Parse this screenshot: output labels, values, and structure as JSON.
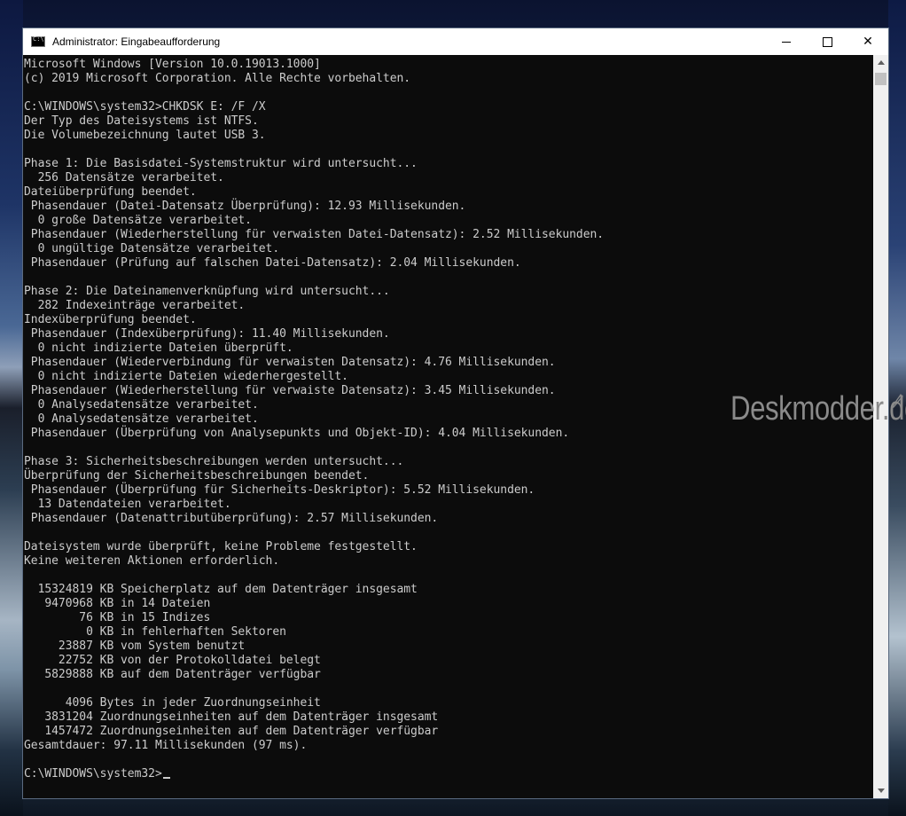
{
  "window": {
    "title": "Administrator: Eingabeaufforderung",
    "icon": "cmd-icon",
    "controls": {
      "minimize": "minimize-icon",
      "maximize": "maximize-icon",
      "close": "✕"
    }
  },
  "console": {
    "lines": [
      "Microsoft Windows [Version 10.0.19013.1000]",
      "(c) 2019 Microsoft Corporation. Alle Rechte vorbehalten.",
      "",
      "C:\\WINDOWS\\system32>CHKDSK E: /F /X",
      "Der Typ des Dateisystems ist NTFS.",
      "Die Volumebezeichnung lautet USB 3.",
      "",
      "Phase 1: Die Basisdatei-Systemstruktur wird untersucht...",
      "  256 Datensätze verarbeitet.",
      "Dateiüberprüfung beendet.",
      " Phasendauer (Datei-Datensatz Überprüfung): 12.93 Millisekunden.",
      "  0 große Datensätze verarbeitet.",
      " Phasendauer (Wiederherstellung für verwaisten Datei-Datensatz): 2.52 Millisekunden.",
      "  0 ungültige Datensätze verarbeitet.",
      " Phasendauer (Prüfung auf falschen Datei-Datensatz): 2.04 Millisekunden.",
      "",
      "Phase 2: Die Dateinamenverknüpfung wird untersucht...",
      "  282 Indexeinträge verarbeitet.",
      "Indexüberprüfung beendet.",
      " Phasendauer (Indexüberprüfung): 11.40 Millisekunden.",
      "  0 nicht indizierte Dateien überprüft.",
      " Phasendauer (Wiederverbindung für verwaisten Datensatz): 4.76 Millisekunden.",
      "  0 nicht indizierte Dateien wiederhergestellt.",
      " Phasendauer (Wiederherstellung für verwaiste Datensatz): 3.45 Millisekunden.",
      "  0 Analysedatensätze verarbeitet.",
      "  0 Analysedatensätze verarbeitet.",
      " Phasendauer (Überprüfung von Analysepunkts und Objekt-ID): 4.04 Millisekunden.",
      "",
      "Phase 3: Sicherheitsbeschreibungen werden untersucht...",
      "Überprüfung der Sicherheitsbeschreibungen beendet.",
      " Phasendauer (Überprüfung für Sicherheits-Deskriptor): 5.52 Millisekunden.",
      "  13 Datendateien verarbeitet.",
      " Phasendauer (Datenattributüberprüfung): 2.57 Millisekunden.",
      "",
      "Dateisystem wurde überprüft, keine Probleme festgestellt.",
      "Keine weiteren Aktionen erforderlich.",
      "",
      "  15324819 KB Speicherplatz auf dem Datenträger insgesamt",
      "   9470968 KB in 14 Dateien",
      "        76 KB in 15 Indizes",
      "         0 KB in fehlerhaften Sektoren",
      "     23887 KB vom System benutzt",
      "     22752 KB von der Protokolldatei belegt",
      "   5829888 KB auf dem Datenträger verfügbar",
      "",
      "      4096 Bytes in jeder Zuordnungseinheit",
      "   3831204 Zuordnungseinheiten auf dem Datenträger insgesamt",
      "   1457472 Zuordnungseinheiten auf dem Datenträger verfügbar",
      "Gesamtdauer: 97.11 Millisekunden (97 ms).",
      ""
    ],
    "prompt": "C:\\WINDOWS\\system32>"
  },
  "watermark": {
    "text": "Deskmodder.de",
    "icon": "pencil-icon"
  },
  "colors": {
    "console_bg": "#0c0c0c",
    "console_fg": "#cccccc",
    "titlebar_bg": "#ffffff"
  }
}
